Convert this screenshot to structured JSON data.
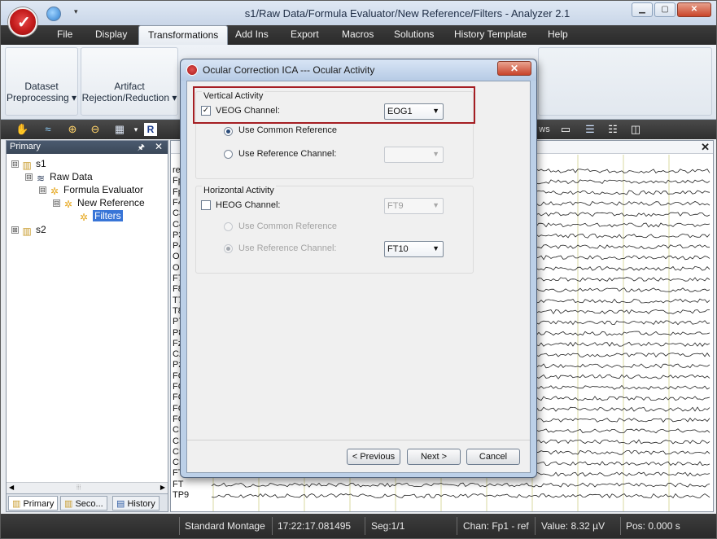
{
  "window": {
    "title": "s1/Raw Data/Formula Evaluator/New Reference/Filters - Analyzer 2.1",
    "buttons": {
      "minimize": "▁",
      "maximize": "▢",
      "close": "✕"
    }
  },
  "menu": {
    "items": [
      "File",
      "Display",
      "Transformations",
      "Add Ins",
      "Export",
      "Macros",
      "Solutions",
      "History Template",
      "Help"
    ],
    "active": "Transformations"
  },
  "ribbon": {
    "groups": [
      {
        "line1": "Dataset",
        "line2": "Preprocessing ▾"
      },
      {
        "line1": "Artifact",
        "line2": "Rejection/Reduction ▾"
      }
    ]
  },
  "left_panel": {
    "title": "Primary",
    "tree": [
      {
        "label": "s1",
        "expander": "⊟",
        "icon": "folder-icon"
      },
      {
        "label": "Raw Data",
        "expander": "⊟",
        "icon": "wave-icon"
      },
      {
        "label": "Formula Evaluator",
        "expander": "⊟",
        "icon": "gear-icon"
      },
      {
        "label": "New Reference",
        "expander": "⊟",
        "icon": "gear-icon"
      },
      {
        "label": "Filters",
        "icon": "gear-icon",
        "selected": true
      },
      {
        "label": "s2",
        "expander": "⊞",
        "icon": "folder-icon"
      }
    ],
    "tabs": [
      "Primary",
      "Seco...",
      "History"
    ]
  },
  "eeg": {
    "channels": [
      "re",
      "Fp",
      "Fp",
      "F4",
      "C3",
      "C4",
      "P3",
      "P4",
      "O1",
      "O2",
      "F7",
      "F8",
      "T7",
      "T8",
      "P7",
      "P8",
      "Fz",
      "Cz",
      "Pz",
      "FC",
      "FC",
      "FC",
      "FC",
      "FC",
      "CP",
      "CP",
      "CP",
      "CP",
      "FT",
      "FT",
      "TP9"
    ]
  },
  "dialog": {
    "title": "Ocular Correction ICA --- Ocular Activity",
    "vertical": {
      "group_title": "Vertical Activity",
      "veog_label": "VEOG Channel:",
      "veog_checked": true,
      "veog_value": "EOG1",
      "common_ref_label": "Use Common Reference",
      "ref_channel_label": "Use Reference Channel:",
      "ref_channel_value": ""
    },
    "horizontal": {
      "group_title": "Horizontal Activity",
      "heog_label": "HEOG Channel:",
      "heog_checked": false,
      "heog_value": "FT9",
      "common_ref_label": "Use Common Reference",
      "ref_channel_label": "Use Reference Channel:",
      "ref_channel_value": "FT10"
    },
    "buttons": {
      "previous": "< Previous",
      "next": "Next >",
      "cancel": "Cancel"
    }
  },
  "toolbar_partial_text": "ws",
  "status": {
    "montage": "Standard Montage",
    "time": "17:22:17.081495",
    "seg": "Seg:1/1",
    "chan": "Chan:  Fp1 - ref",
    "value": "Value: 8.32 µV",
    "pos": "Pos:  0.000 s"
  },
  "colors": {
    "highlight": "#a51e23",
    "selection": "#3875d7"
  }
}
